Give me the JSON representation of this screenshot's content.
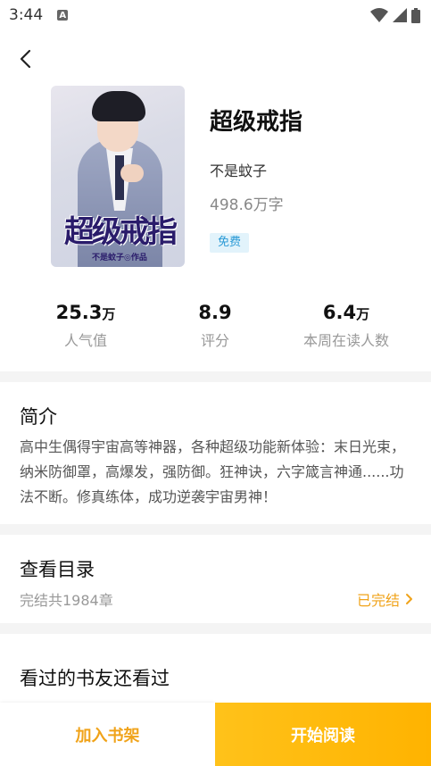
{
  "status_bar": {
    "time": "3:44",
    "notification_icon": "A"
  },
  "book": {
    "cover_title": "超级戒指",
    "cover_author": "不是蚊子◎作品",
    "title": "超级戒指",
    "author": "不是蚊子",
    "word_count": "498.6万字",
    "tag": "免费"
  },
  "stats": [
    {
      "value": "25.3",
      "unit": "万",
      "label": "人气值"
    },
    {
      "value": "8.9",
      "unit": "",
      "label": "评分"
    },
    {
      "value": "6.4",
      "unit": "万",
      "label": "本周在读人数"
    }
  ],
  "intro": {
    "title": "简介",
    "text": "高中生偶得宇宙高等神器，各种超级功能新体验：末日光束，纳米防御罩，高爆发，强防御。狂神诀，六字箴言神通......功法不断。修真练体，成功逆袭宇宙男神！"
  },
  "toc": {
    "title": "查看目录",
    "subtitle": "完结共1984章",
    "status": "已完结"
  },
  "also_read": {
    "title": "看过的书友还看过"
  },
  "actions": {
    "add_shelf": "加入书架",
    "start_reading": "开始阅读"
  }
}
